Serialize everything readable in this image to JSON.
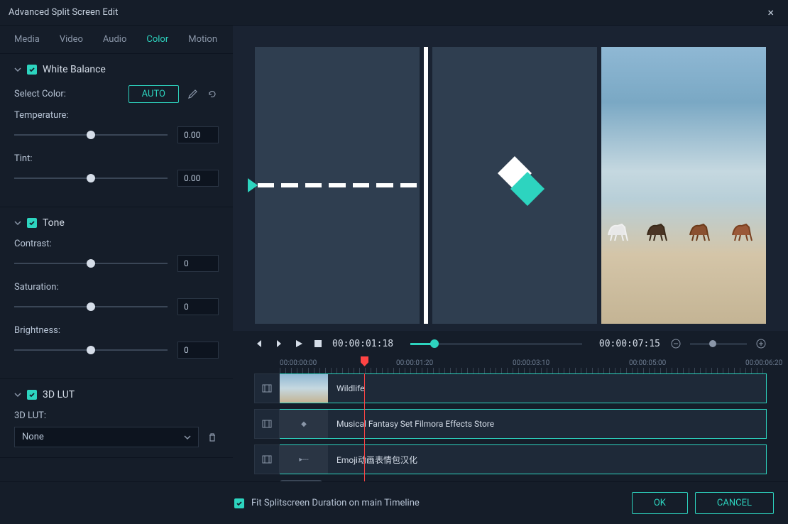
{
  "window": {
    "title": "Advanced Split Screen Edit"
  },
  "tabs": [
    "Media",
    "Video",
    "Audio",
    "Color",
    "Motion"
  ],
  "activeTab": "Color",
  "sections": {
    "whiteBalance": {
      "title": "White Balance",
      "selectColorLabel": "Select Color:",
      "autoLabel": "AUTO",
      "temperature": {
        "label": "Temperature:",
        "value": "0.00"
      },
      "tint": {
        "label": "Tint:",
        "value": "0.00"
      }
    },
    "tone": {
      "title": "Tone",
      "contrast": {
        "label": "Contrast:",
        "value": "0"
      },
      "saturation": {
        "label": "Saturation:",
        "value": "0"
      },
      "brightness": {
        "label": "Brightness:",
        "value": "0"
      }
    },
    "lut": {
      "title": "3D LUT",
      "label": "3D LUT:",
      "value": "None"
    }
  },
  "transport": {
    "current": "00:00:01:18",
    "duration": "00:00:07:15"
  },
  "ruler": [
    "00:00:00:00",
    "00:00:01:20",
    "00:00:03:10",
    "00:00:05:00",
    "00:00:06:20"
  ],
  "tracks": [
    {
      "label": "Wildlife"
    },
    {
      "label": "Musical Fantasy Set Filmora Effects Store"
    },
    {
      "label": "Emoji动画表情包汉化"
    }
  ],
  "footer": {
    "fitLabel": "Fit Splitscreen Duration on main Timeline",
    "ok": "OK",
    "cancel": "CANCEL"
  }
}
